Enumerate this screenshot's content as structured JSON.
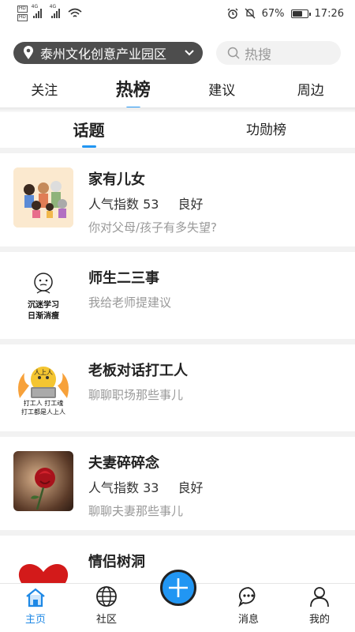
{
  "status_bar": {
    "hd1": "HD",
    "hd2": "HD",
    "net1": "4G",
    "net2": "4G",
    "battery_text": "67%",
    "battery_level": 0.67,
    "time": "17:26"
  },
  "header": {
    "location": "泰州文化创意产业园区",
    "search_placeholder": "热搜"
  },
  "main_tabs": [
    {
      "label": "关注"
    },
    {
      "label": "热榜"
    },
    {
      "label": "建议"
    },
    {
      "label": "周边"
    }
  ],
  "sub_tabs": [
    {
      "label": "话题"
    },
    {
      "label": "功勋榜"
    }
  ],
  "topics": [
    {
      "title": "家有儿女",
      "metric_label": "人气指数 53",
      "metric_status": "良好",
      "desc": "你对父母/孩子有多失望?"
    },
    {
      "title": "师生二三事",
      "desc": "我给老师提建议",
      "thumb_text1": "沉迷学习",
      "thumb_text2": "日渐消瘦"
    },
    {
      "title": "老板对话打工人",
      "desc": "聊聊职场那些事儿",
      "thumb_badge": "人上人",
      "thumb_text1": "打工人 打工魂",
      "thumb_text2": "打工都是人上人"
    },
    {
      "title": "夫妻碎碎念",
      "metric_label": "人气指数 33",
      "metric_status": "良好",
      "desc": "聊聊夫妻那些事儿"
    },
    {
      "title": "情侣树洞"
    }
  ],
  "bottom_nav": [
    {
      "label": "主页"
    },
    {
      "label": "社区"
    },
    {
      "label": "消息"
    },
    {
      "label": "我的"
    }
  ],
  "colors": {
    "accent": "#2196f3",
    "location_bg": "#4d4d4d"
  }
}
